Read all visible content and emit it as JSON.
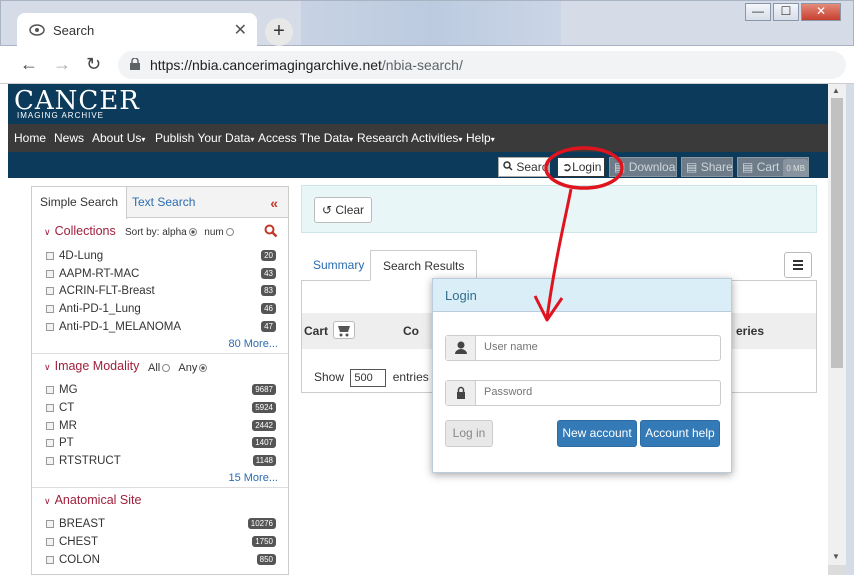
{
  "browser": {
    "tab_title": "Search",
    "tab_close": "✕",
    "newtab": "+",
    "url_host": "https://nbia.cancerimagingarchive.net",
    "url_path": "/nbia-search/",
    "win_minimize": "—",
    "win_maximize": "☐",
    "win_close": "✕"
  },
  "logo": {
    "main": "CANCER",
    "sub": "IMAGING ARCHIVE"
  },
  "nav": {
    "items": [
      {
        "label": "Home"
      },
      {
        "label": "News"
      },
      {
        "label": "About Us"
      },
      {
        "label": "Publish Your Data"
      },
      {
        "label": "Access The Data"
      },
      {
        "label": "Research Activities"
      },
      {
        "label": "Help"
      }
    ]
  },
  "toolbar": {
    "search": "Search",
    "login": "Login",
    "download": "Download",
    "share": "Share",
    "cart": "Cart",
    "cart_size": "0 MB"
  },
  "left": {
    "tab_simple": "Simple Search",
    "tab_text": "Text Search",
    "collapse": "«",
    "collections": {
      "title": "Collections",
      "sort_label": "Sort by:",
      "sort_alpha": "alpha",
      "sort_num": "num",
      "items": [
        {
          "label": "4D-Lung",
          "count": "20"
        },
        {
          "label": "AAPM-RT-MAC",
          "count": "43"
        },
        {
          "label": "ACRIN-FLT-Breast",
          "count": "83"
        },
        {
          "label": "Anti-PD-1_Lung",
          "count": "46"
        },
        {
          "label": "Anti-PD-1_MELANOMA",
          "count": "47"
        }
      ],
      "more": "80 More..."
    },
    "modality": {
      "title": "Image Modality",
      "all": "All",
      "any": "Any",
      "items": [
        {
          "label": "MG",
          "count": "9687"
        },
        {
          "label": "CT",
          "count": "5924"
        },
        {
          "label": "MR",
          "count": "2442"
        },
        {
          "label": "PT",
          "count": "1407"
        },
        {
          "label": "RTSTRUCT",
          "count": "1148"
        }
      ],
      "more": "15 More..."
    },
    "anatomical": {
      "title": "Anatomical Site",
      "items": [
        {
          "label": "BREAST",
          "count": "10276"
        },
        {
          "label": "CHEST",
          "count": "1750"
        },
        {
          "label": "COLON",
          "count": "850"
        }
      ]
    }
  },
  "right": {
    "clear": "Clear",
    "tab_summary": "Summary",
    "tab_results": "Search Results",
    "col_cart": "Cart",
    "col_partial": "Co",
    "col_series": "eries",
    "show_label": "Show",
    "show_value": "500",
    "entries_label": "entries"
  },
  "login_modal": {
    "title": "Login",
    "username_placeholder": "User name",
    "password_placeholder": "Password",
    "login_btn": "Log in",
    "new_account": "New account",
    "account_help": "Account help"
  },
  "colors": {
    "header_bg": "#0c3a5b",
    "nav_bg": "#3a3a3a",
    "accent_red": "#e0141e",
    "link_blue": "#2b6cb0",
    "primary_btn": "#337ab7"
  }
}
